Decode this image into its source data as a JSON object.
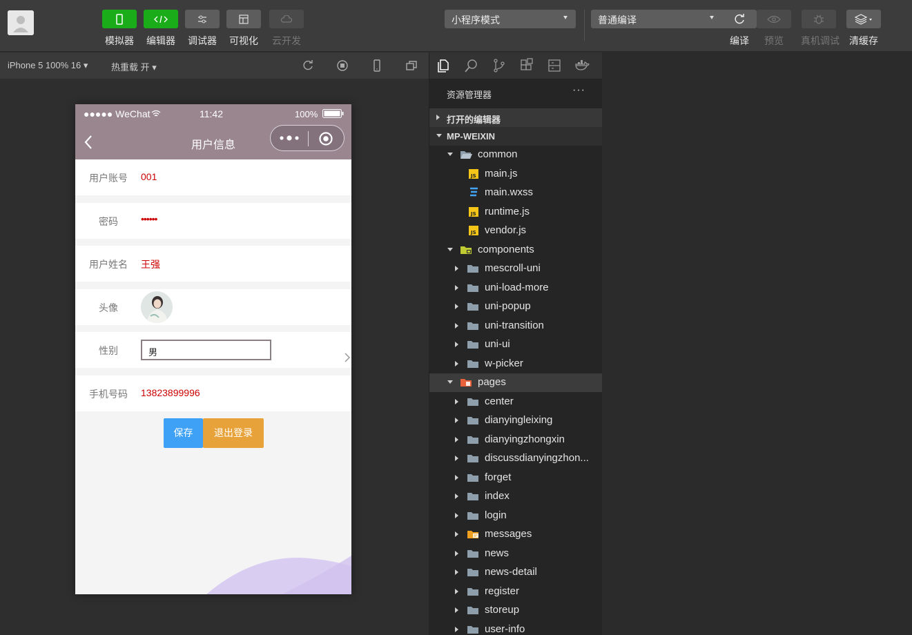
{
  "toolbar": {
    "tools": [
      {
        "label": "模拟器",
        "style": "green",
        "icon": "phone-icon"
      },
      {
        "label": "编辑器",
        "style": "green",
        "icon": "code-icon"
      },
      {
        "label": "调试器",
        "style": "gray",
        "icon": "sliders-icon"
      },
      {
        "label": "可视化",
        "style": "gray",
        "icon": "layout-icon"
      },
      {
        "label": "云开发",
        "style": "dim",
        "icon": "cloud-icon"
      }
    ],
    "mode_select": "小程序模式",
    "compile_select": "普通编译",
    "actions": [
      {
        "label": "编译",
        "icon": "refresh-icon",
        "enabled": true
      },
      {
        "label": "预览",
        "icon": "eye-icon",
        "enabled": false
      },
      {
        "label": "真机调试",
        "icon": "bug-icon",
        "enabled": false
      },
      {
        "label": "清缓存",
        "icon": "layers-icon",
        "enabled": true
      }
    ]
  },
  "simbar": {
    "device": "iPhone 5 100% 16 ▾",
    "hotreload": "热重载 开 ▾"
  },
  "phone": {
    "status": {
      "carrier": "●●●●● WeChat",
      "time": "11:42",
      "battery": "100%"
    },
    "nav_title": "用户信息",
    "fields": [
      {
        "label": "用户账号",
        "value": "001"
      },
      {
        "label": "密码",
        "value": "••••••"
      },
      {
        "label": "用户姓名",
        "value": "王强"
      },
      {
        "label": "头像",
        "value": ""
      },
      {
        "label": "性别",
        "value": "男"
      },
      {
        "label": "手机号码",
        "value": "13823899996"
      }
    ],
    "save_label": "保存",
    "logout_label": "退出登录"
  },
  "explorer": {
    "title": "资源管理器",
    "more": "···",
    "open_editors": "打开的编辑器",
    "project": "MP-WEIXIN",
    "tree": [
      {
        "name": "common",
        "depth": 1,
        "type": "folder-open",
        "expanded": true
      },
      {
        "name": "main.js",
        "depth": 2,
        "type": "js"
      },
      {
        "name": "main.wxss",
        "depth": 2,
        "type": "css"
      },
      {
        "name": "runtime.js",
        "depth": 2,
        "type": "js"
      },
      {
        "name": "vendor.js",
        "depth": 2,
        "type": "js"
      },
      {
        "name": "components",
        "depth": 1,
        "type": "folder-components",
        "expanded": true
      },
      {
        "name": "mescroll-uni",
        "depth": 2,
        "type": "folder"
      },
      {
        "name": "uni-load-more",
        "depth": 2,
        "type": "folder"
      },
      {
        "name": "uni-popup",
        "depth": 2,
        "type": "folder"
      },
      {
        "name": "uni-transition",
        "depth": 2,
        "type": "folder"
      },
      {
        "name": "uni-ui",
        "depth": 2,
        "type": "folder"
      },
      {
        "name": "w-picker",
        "depth": 2,
        "type": "folder"
      },
      {
        "name": "pages",
        "depth": 1,
        "type": "folder-pages",
        "expanded": true,
        "selected": true
      },
      {
        "name": "center",
        "depth": 2,
        "type": "folder"
      },
      {
        "name": "dianyingleixing",
        "depth": 2,
        "type": "folder"
      },
      {
        "name": "dianyingzhongxin",
        "depth": 2,
        "type": "folder"
      },
      {
        "name": "discussdianyingzhon...",
        "depth": 2,
        "type": "folder"
      },
      {
        "name": "forget",
        "depth": 2,
        "type": "folder"
      },
      {
        "name": "index",
        "depth": 2,
        "type": "folder"
      },
      {
        "name": "login",
        "depth": 2,
        "type": "folder"
      },
      {
        "name": "messages",
        "depth": 2,
        "type": "folder-messages"
      },
      {
        "name": "news",
        "depth": 2,
        "type": "folder"
      },
      {
        "name": "news-detail",
        "depth": 2,
        "type": "folder"
      },
      {
        "name": "register",
        "depth": 2,
        "type": "folder"
      },
      {
        "name": "storeup",
        "depth": 2,
        "type": "folder"
      },
      {
        "name": "user-info",
        "depth": 2,
        "type": "folder"
      }
    ]
  },
  "colors": {
    "green": "#1aad19",
    "nav": "#9a868f",
    "save": "#3ea1f5",
    "logout": "#e8a23a",
    "value_red": "#cc0000"
  }
}
